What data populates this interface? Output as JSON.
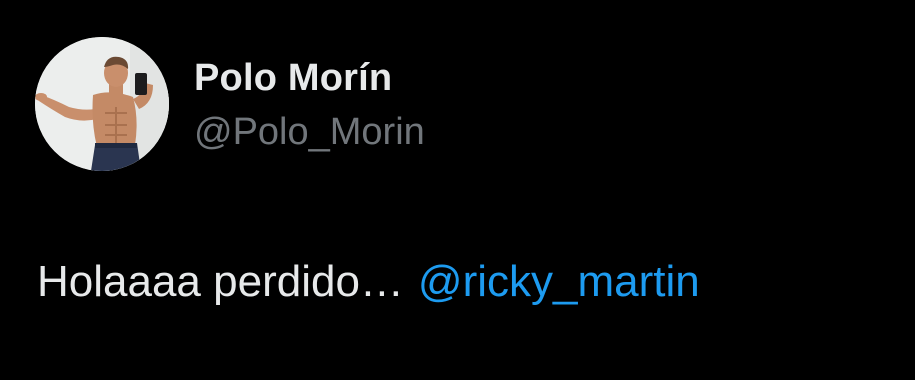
{
  "author": {
    "display_name": "Polo Morín",
    "handle": "@Polo_Morin",
    "avatar_icon": "profile-photo"
  },
  "tweet": {
    "text": "Holaaaa perdido…",
    "mention": "@ricky_martin"
  },
  "colors": {
    "background": "#000000",
    "name": "#e7e9ea",
    "handle": "#71767b",
    "text": "#e7e9ea",
    "link": "#1d9bf0"
  }
}
